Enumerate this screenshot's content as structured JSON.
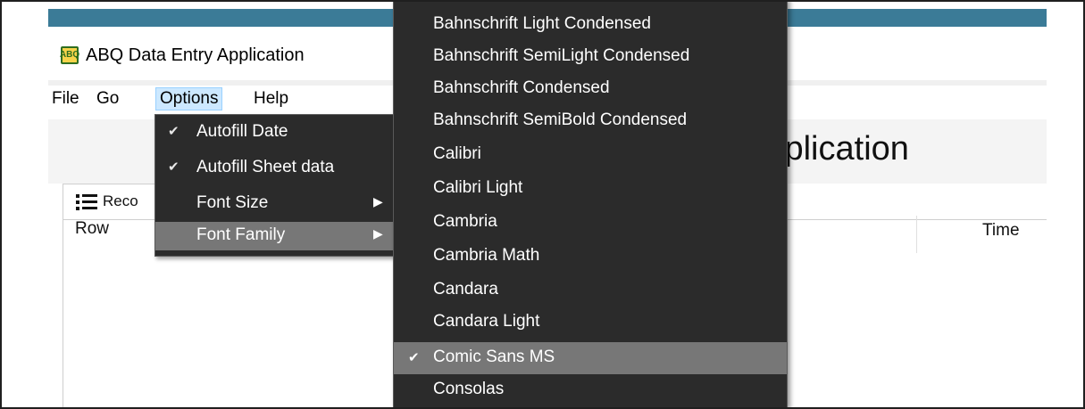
{
  "window": {
    "title": "ABQ Data Entry Application",
    "icon_text": "ABQ",
    "accent_color": "#3b7b97"
  },
  "menubar": {
    "items": [
      {
        "label": "File"
      },
      {
        "label": "Go"
      },
      {
        "label": "Options"
      },
      {
        "label": "Help"
      }
    ],
    "active": "Options"
  },
  "main": {
    "heading": "Application",
    "tab": {
      "label": "Reco",
      "icon": "list-icon"
    },
    "columns": {
      "row": "Row",
      "time": "Time"
    }
  },
  "options_menu": {
    "items": [
      {
        "label": "Autofill Date",
        "checked": true
      },
      {
        "label": "Autofill Sheet data",
        "checked": true
      },
      {
        "label": "Font Size",
        "submenu": true
      },
      {
        "label": "Font Family",
        "submenu": true,
        "highlighted": true
      }
    ]
  },
  "font_family_menu": {
    "items": [
      {
        "label": "Bahnschrift Light Condensed"
      },
      {
        "label": "Bahnschrift SemiLight Condensed"
      },
      {
        "label": "Bahnschrift Condensed"
      },
      {
        "label": "Bahnschrift SemiBold Condensed"
      },
      {
        "label": "Calibri"
      },
      {
        "label": "Calibri Light"
      },
      {
        "label": "Cambria"
      },
      {
        "label": "Cambria Math"
      },
      {
        "label": "Candara"
      },
      {
        "label": "Candara Light"
      },
      {
        "label": "Comic Sans MS",
        "checked": true,
        "highlighted": true
      },
      {
        "label": "Consolas"
      }
    ],
    "check_glyph": "✔",
    "arrow_glyph": "▶"
  }
}
